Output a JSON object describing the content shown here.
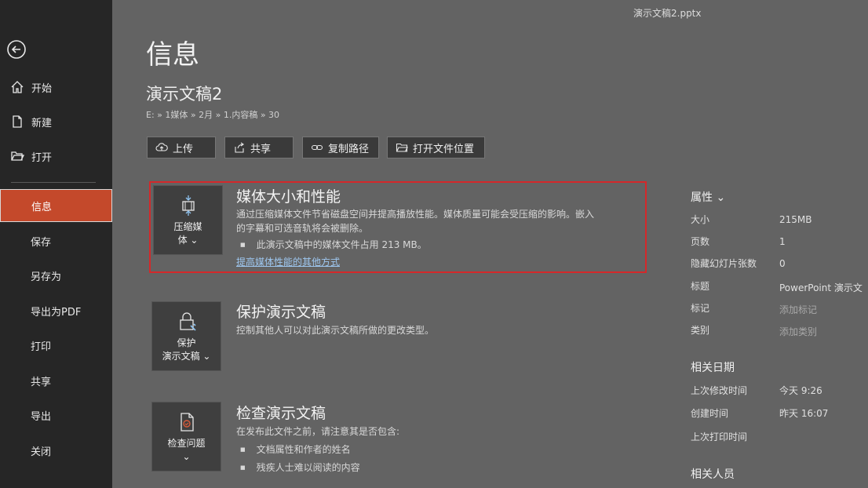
{
  "window": {
    "filename": "演示文稿2.pptx"
  },
  "sidebar": {
    "items": [
      {
        "label": "开始",
        "icon": "home-icon"
      },
      {
        "label": "新建",
        "icon": "new-document-icon"
      },
      {
        "label": "打开",
        "icon": "open-folder-icon"
      },
      {
        "label": "信息",
        "active": true
      },
      {
        "label": "保存"
      },
      {
        "label": "另存为"
      },
      {
        "label": "导出为PDF"
      },
      {
        "label": "打印"
      },
      {
        "label": "共享"
      },
      {
        "label": "导出"
      },
      {
        "label": "关闭"
      }
    ]
  },
  "main": {
    "page_title": "信息",
    "doc_name": "演示文稿2",
    "doc_path": "E: » 1媒体 » 2月 » 1.内容稿 » 30",
    "actions": [
      {
        "label": "上传",
        "icon": "cloud-upload-icon"
      },
      {
        "label": "共享",
        "icon": "share-icon"
      },
      {
        "label": "复制路径",
        "icon": "link-icon"
      },
      {
        "label": "打开文件位置",
        "icon": "folder-icon"
      }
    ],
    "sections": {
      "media": {
        "tile_label_1": "压缩媒",
        "tile_label_2": "体 ⌄",
        "title": "媒体大小和性能",
        "desc_1": "通过压缩媒体文件节省磁盘空间并提高播放性能。媒体质量可能会受压缩的影响。嵌入",
        "desc_2": "的字幕和可选音轨将会被删除。",
        "bullet": "此演示文稿中的媒体文件占用 213 MB。",
        "link": "提高媒体性能的其他方式"
      },
      "protect": {
        "tile_label_1": "保护",
        "tile_label_2": "演示文稿 ⌄",
        "title": "保护演示文稿",
        "desc": "控制其他人可以对此演示文稿所做的更改类型。"
      },
      "inspect": {
        "tile_label_1": "检查问题",
        "tile_label_2": "⌄",
        "title": "检查演示文稿",
        "desc": "在发布此文件之前，请注意其是否包含:",
        "bullet_1": "文档属性和作者的姓名",
        "bullet_2": "残疾人士难以阅读的内容"
      }
    }
  },
  "properties": {
    "title": "属性 ⌄",
    "rows": [
      {
        "label": "大小",
        "value": "215MB"
      },
      {
        "label": "页数",
        "value": "1"
      },
      {
        "label": "隐藏幻灯片张数",
        "value": "0"
      },
      {
        "label": "标题",
        "value": "PowerPoint 演示文"
      },
      {
        "label": "标记",
        "value": "添加标记"
      },
      {
        "label": "类别",
        "value": "添加类别"
      }
    ],
    "dates_title": "相关日期",
    "dates": [
      {
        "label": "上次修改时间",
        "value": "今天 9:26"
      },
      {
        "label": "创建时间",
        "value": "昨天 16:07"
      },
      {
        "label": "上次打印时间",
        "value": ""
      }
    ],
    "people_title": "相关人员"
  }
}
